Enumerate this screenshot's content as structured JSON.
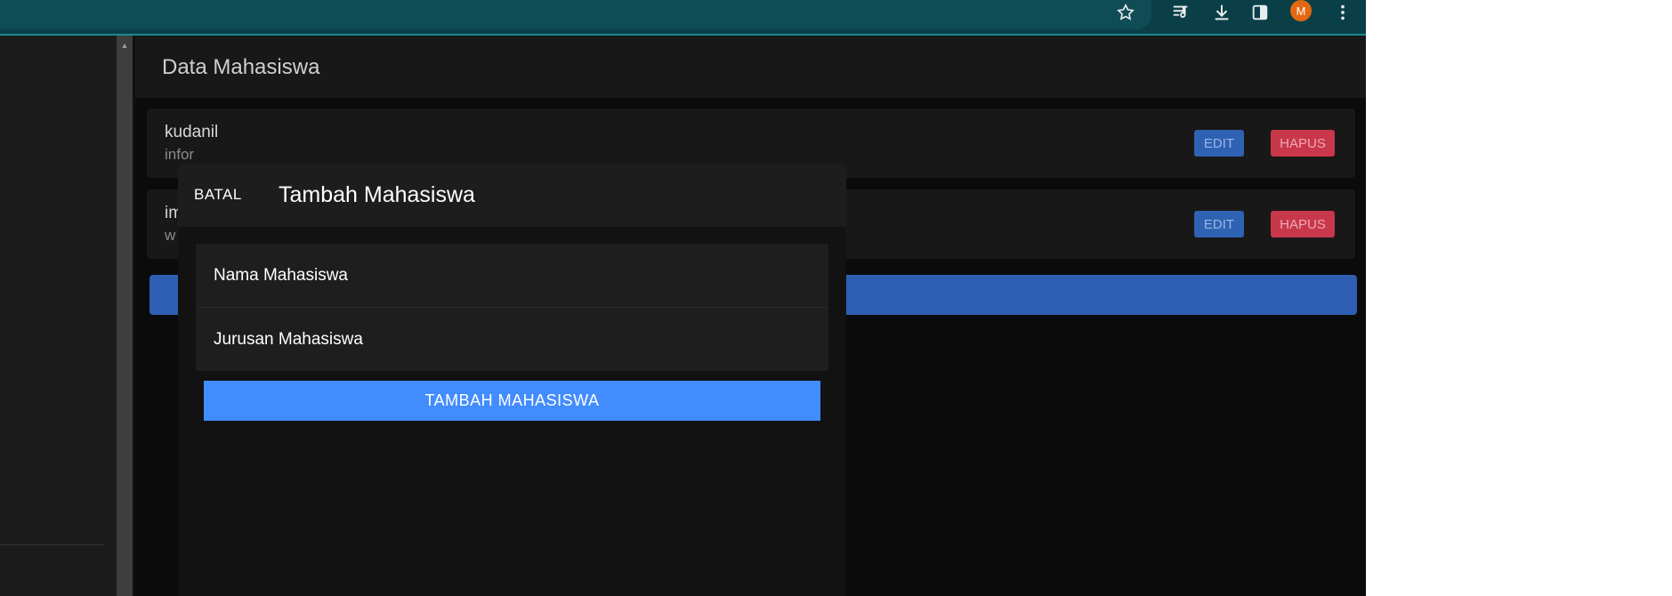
{
  "browser": {
    "url_fragment": "va",
    "avatar_initial": "M",
    "icons": [
      "star-icon",
      "media-queue-icon",
      "download-icon",
      "side-panel-icon",
      "more-vert-icon"
    ]
  },
  "app": {
    "title": "Data Mahasiswa",
    "students": [
      {
        "name": "kudanil",
        "major": "infor",
        "edit_label": "EDIT",
        "delete_label": "HAPUS"
      },
      {
        "name": "im",
        "major": "w",
        "edit_label": "EDIT",
        "delete_label": "HAPUS"
      }
    ]
  },
  "modal": {
    "cancel_label": "BATAL",
    "title": "Tambah Mahasiswa",
    "fields": [
      {
        "label": "Nama Mahasiswa"
      },
      {
        "label": "Jurusan Mahasiswa"
      }
    ],
    "submit_label": "TAMBAH MAHASISWA"
  },
  "colors": {
    "edit": "#3062b3",
    "delete": "#c8374a",
    "submit": "#428cfe",
    "chrome": "#0b3f47"
  }
}
